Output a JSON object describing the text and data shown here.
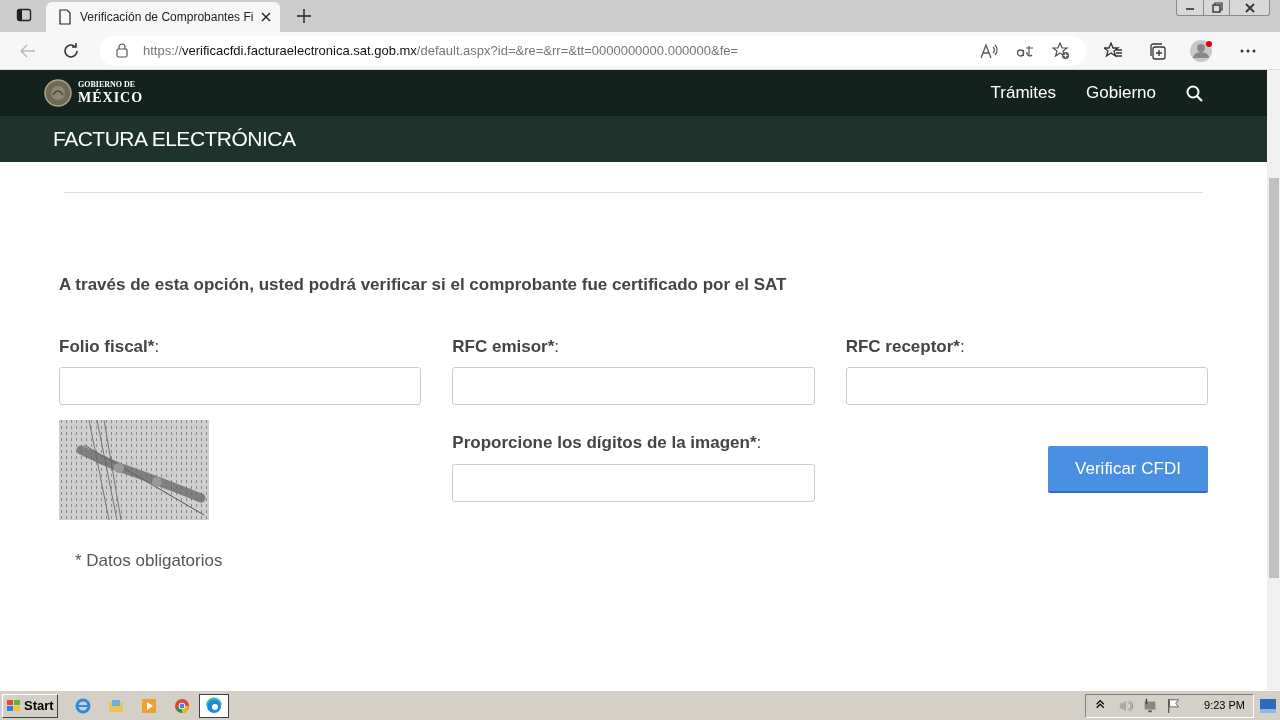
{
  "browser": {
    "tab": {
      "title": "Verificación de Comprobantes Fi",
      "selected": true
    },
    "url": {
      "scheme": "https://",
      "host": "verificacfdi.facturaelectronica.sat.gob.mx",
      "path": "/default.aspx?id=&re=&rr=&tt=0000000000.000000&fe="
    }
  },
  "site_header": {
    "logo_top": "GOBIERNO DE",
    "logo_bottom": "MÉXICO",
    "nav": [
      "Trámites",
      "Gobierno"
    ]
  },
  "section_title": "FACTURA ELECTRÓNICA",
  "form": {
    "intro": "A través de esta opción, usted podrá verificar si el comprobante fue certificado por el SAT",
    "fields": [
      {
        "label": "Folio fiscal*",
        "colon": ":"
      },
      {
        "label": "RFC emisor*",
        "colon": ":"
      },
      {
        "label": "RFC receptor*",
        "colon": ":"
      }
    ],
    "captcha_field": {
      "label": "Proporcione los dígitos de la imagen*",
      "colon": ":"
    },
    "submit": "Verificar CFDI",
    "note": "* Datos obligatorios"
  },
  "taskbar": {
    "start": "Start",
    "clock": "9:23 PM"
  }
}
